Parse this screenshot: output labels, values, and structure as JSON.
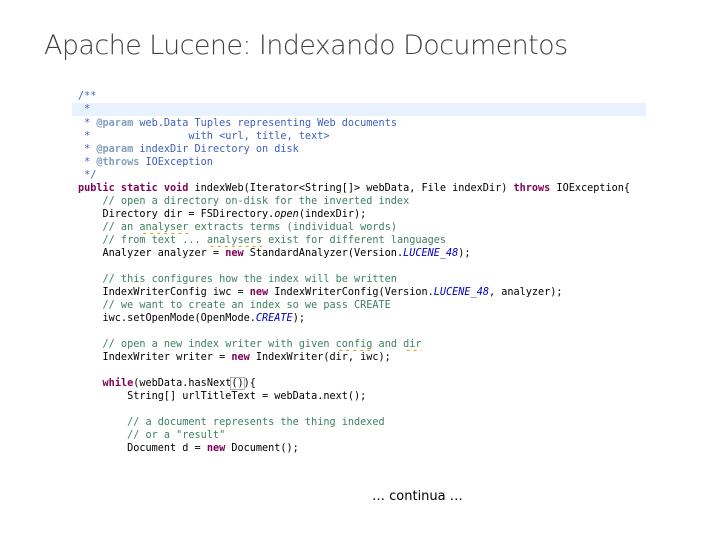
{
  "slide": {
    "title": "Apache Lucene: Indexando Documentos",
    "footer": "… continua …"
  },
  "code": {
    "lines": [
      {
        "highlight": false,
        "tokens": [
          {
            "t": "/**",
            "c": "doc"
          }
        ]
      },
      {
        "highlight": true,
        "tokens": [
          {
            "t": " *",
            "c": "doc"
          }
        ]
      },
      {
        "highlight": false,
        "tokens": [
          {
            "t": " * ",
            "c": "doc"
          },
          {
            "t": "@param",
            "c": "tag"
          },
          {
            "t": " web.Data Tuples representing Web documents",
            "c": "doc"
          }
        ]
      },
      {
        "highlight": false,
        "tokens": [
          {
            "t": " *                with <url, title, text>",
            "c": "doc"
          }
        ]
      },
      {
        "highlight": false,
        "tokens": [
          {
            "t": " * ",
            "c": "doc"
          },
          {
            "t": "@param",
            "c": "tag"
          },
          {
            "t": " indexDir Directory on disk",
            "c": "doc"
          }
        ]
      },
      {
        "highlight": false,
        "tokens": [
          {
            "t": " * ",
            "c": "doc"
          },
          {
            "t": "@throws",
            "c": "tag"
          },
          {
            "t": " IOException",
            "c": "doc"
          }
        ]
      },
      {
        "highlight": false,
        "tokens": [
          {
            "t": " */",
            "c": "doc"
          }
        ]
      },
      {
        "highlight": false,
        "tokens": [
          {
            "t": "public static void",
            "c": "kw"
          },
          {
            "t": " indexWeb(Iterator<String[]> webData, File indexDir) ",
            "c": "plain"
          },
          {
            "t": "throws",
            "c": "kw"
          },
          {
            "t": " IOException{",
            "c": "plain"
          }
        ]
      },
      {
        "highlight": false,
        "tokens": [
          {
            "t": "    // open a directory on-disk for the inverted index",
            "c": "com"
          }
        ]
      },
      {
        "highlight": false,
        "tokens": [
          {
            "t": "    Directory dir = FSDirectory.",
            "c": "plain"
          },
          {
            "t": "open",
            "c": "static"
          },
          {
            "t": "(indexDir);",
            "c": "plain"
          }
        ]
      },
      {
        "highlight": false,
        "tokens": [
          {
            "t": "    // an ",
            "c": "com"
          },
          {
            "t": "analyser",
            "c": "com-warn"
          },
          {
            "t": " extracts terms (individual words)",
            "c": "com"
          }
        ]
      },
      {
        "highlight": false,
        "tokens": [
          {
            "t": "    // from text ... ",
            "c": "com"
          },
          {
            "t": "analysers",
            "c": "com-warn"
          },
          {
            "t": " exist for different languages",
            "c": "com"
          }
        ]
      },
      {
        "highlight": false,
        "tokens": [
          {
            "t": "    Analyzer analyzer = ",
            "c": "plain"
          },
          {
            "t": "new",
            "c": "kw"
          },
          {
            "t": " StandardAnalyzer(Version.",
            "c": "plain"
          },
          {
            "t": "LUCENE_48",
            "c": "const"
          },
          {
            "t": ");",
            "c": "plain"
          }
        ]
      },
      {
        "highlight": false,
        "tokens": [
          {
            "t": "",
            "c": "plain"
          }
        ]
      },
      {
        "highlight": false,
        "tokens": [
          {
            "t": "    // this configures how the index will be written",
            "c": "com"
          }
        ]
      },
      {
        "highlight": false,
        "tokens": [
          {
            "t": "    IndexWriterConfig iwc = ",
            "c": "plain"
          },
          {
            "t": "new",
            "c": "kw"
          },
          {
            "t": " IndexWriterConfig(Version.",
            "c": "plain"
          },
          {
            "t": "LUCENE_48",
            "c": "const"
          },
          {
            "t": ", analyzer);",
            "c": "plain"
          }
        ]
      },
      {
        "highlight": false,
        "tokens": [
          {
            "t": "    // we want to create an index so we pass CREATE",
            "c": "com"
          }
        ]
      },
      {
        "highlight": false,
        "tokens": [
          {
            "t": "    iwc.setOpenMode(OpenMode.",
            "c": "plain"
          },
          {
            "t": "CREATE",
            "c": "const"
          },
          {
            "t": ");",
            "c": "plain"
          }
        ]
      },
      {
        "highlight": false,
        "tokens": [
          {
            "t": "",
            "c": "plain"
          }
        ]
      },
      {
        "highlight": false,
        "tokens": [
          {
            "t": "    // open a new index writer with given ",
            "c": "com"
          },
          {
            "t": "config",
            "c": "com-warn"
          },
          {
            "t": " and ",
            "c": "com"
          },
          {
            "t": "dir",
            "c": "com-warn"
          }
        ]
      },
      {
        "highlight": false,
        "tokens": [
          {
            "t": "    IndexWriter writer = ",
            "c": "plain"
          },
          {
            "t": "new",
            "c": "kw"
          },
          {
            "t": " IndexWriter(dir, iwc);",
            "c": "plain"
          }
        ]
      },
      {
        "highlight": false,
        "tokens": [
          {
            "t": "",
            "c": "plain"
          }
        ]
      },
      {
        "highlight": false,
        "tokens": [
          {
            "t": "    ",
            "c": "plain"
          },
          {
            "t": "while",
            "c": "kw"
          },
          {
            "t": "(webData.hasNext",
            "c": "plain"
          },
          {
            "t": "()",
            "c": "bracket"
          },
          {
            "t": "){",
            "c": "plain"
          }
        ]
      },
      {
        "highlight": false,
        "tokens": [
          {
            "t": "        String[] urlTitleText = webData.next();",
            "c": "plain"
          }
        ]
      },
      {
        "highlight": false,
        "tokens": [
          {
            "t": "",
            "c": "plain"
          }
        ]
      },
      {
        "highlight": false,
        "tokens": [
          {
            "t": "        // a document represents the thing indexed",
            "c": "com"
          }
        ]
      },
      {
        "highlight": false,
        "tokens": [
          {
            "t": "        // or a \"result\"",
            "c": "com"
          }
        ]
      },
      {
        "highlight": false,
        "tokens": [
          {
            "t": "        Document d = ",
            "c": "plain"
          },
          {
            "t": "new",
            "c": "kw"
          },
          {
            "t": " Document();",
            "c": "plain"
          }
        ]
      }
    ]
  }
}
